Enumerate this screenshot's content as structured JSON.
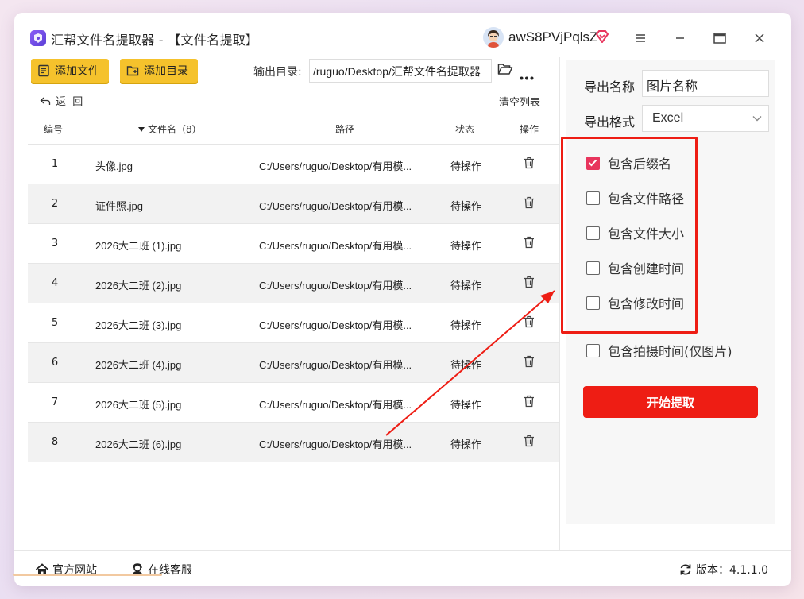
{
  "window": {
    "title": "汇帮文件名提取器 - 【文件名提取】",
    "username": "awS8PVjPqlsZ"
  },
  "toolbar": {
    "add_file_label": "添加文件",
    "add_dir_label": "添加目录",
    "output_label": "输出目录:",
    "output_path": "/ruguo/Desktop/汇帮文件名提取器",
    "back_label": "返  回",
    "clear_label": "清空列表"
  },
  "table": {
    "headers": {
      "no": "编号",
      "name": "文件名（8）",
      "path": "路径",
      "status": "状态",
      "op": "操作"
    },
    "rows": [
      {
        "no": "1",
        "name": "头像.jpg",
        "path": "C:/Users/ruguo/Desktop/有用模...",
        "status": "待操作"
      },
      {
        "no": "2",
        "name": "证件照.jpg",
        "path": "C:/Users/ruguo/Desktop/有用模...",
        "status": "待操作"
      },
      {
        "no": "3",
        "name": "2026大二班 (1).jpg",
        "path": "C:/Users/ruguo/Desktop/有用模...",
        "status": "待操作"
      },
      {
        "no": "4",
        "name": "2026大二班 (2).jpg",
        "path": "C:/Users/ruguo/Desktop/有用模...",
        "status": "待操作"
      },
      {
        "no": "5",
        "name": "2026大二班 (3).jpg",
        "path": "C:/Users/ruguo/Desktop/有用模...",
        "status": "待操作"
      },
      {
        "no": "6",
        "name": "2026大二班 (4).jpg",
        "path": "C:/Users/ruguo/Desktop/有用模...",
        "status": "待操作"
      },
      {
        "no": "7",
        "name": "2026大二班 (5).jpg",
        "path": "C:/Users/ruguo/Desktop/有用模...",
        "status": "待操作"
      },
      {
        "no": "8",
        "name": "2026大二班 (6).jpg",
        "path": "C:/Users/ruguo/Desktop/有用模...",
        "status": "待操作"
      }
    ]
  },
  "settings": {
    "export_name_label": "导出名称",
    "export_name_value": "图片名称",
    "export_format_label": "导出格式",
    "export_format_value": "Excel",
    "options": [
      {
        "label": "包含后缀名",
        "checked": true
      },
      {
        "label": "包含文件路径",
        "checked": false
      },
      {
        "label": "包含文件大小",
        "checked": false
      },
      {
        "label": "包含创建时间",
        "checked": false
      },
      {
        "label": "包含修改时间",
        "checked": false
      },
      {
        "label": "包含拍摄时间(仅图片)",
        "checked": false
      }
    ],
    "start_label": "开始提取"
  },
  "footer": {
    "home_label": "官方网站",
    "support_label": "在线客服",
    "version_label": "版本：4.1.1.0"
  },
  "colors": {
    "accent_yellow": "#f5c22c",
    "accent_red": "#ee1d14",
    "checkbox_checked": "#e8355d"
  }
}
